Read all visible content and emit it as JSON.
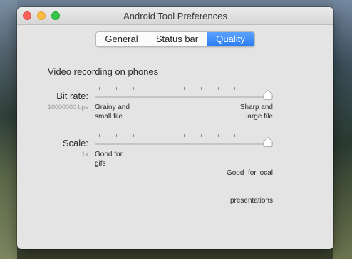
{
  "window": {
    "title": "Android Tool Preferences"
  },
  "tabs": [
    {
      "label": "General",
      "selected": false
    },
    {
      "label": "Status bar",
      "selected": false
    },
    {
      "label": "Quality",
      "selected": true
    }
  ],
  "section": {
    "title": "Video recording on phones"
  },
  "bitrate": {
    "label": "Bit rate:",
    "value": "10000000 bps",
    "min_note_line1": "Grainy and",
    "min_note_line2": "small file",
    "max_note_line1": "Sharp and",
    "max_note_line2": "large file",
    "level": 1.0
  },
  "scale": {
    "label": "Scale:",
    "value": "1x",
    "min_note_line1": "Good for",
    "min_note_line2": "gifs",
    "max_note_line1": "Good  for local",
    "max_note_line2": "presentations",
    "level": 1.0
  },
  "colors": {
    "accent": "#2a7cf2"
  }
}
